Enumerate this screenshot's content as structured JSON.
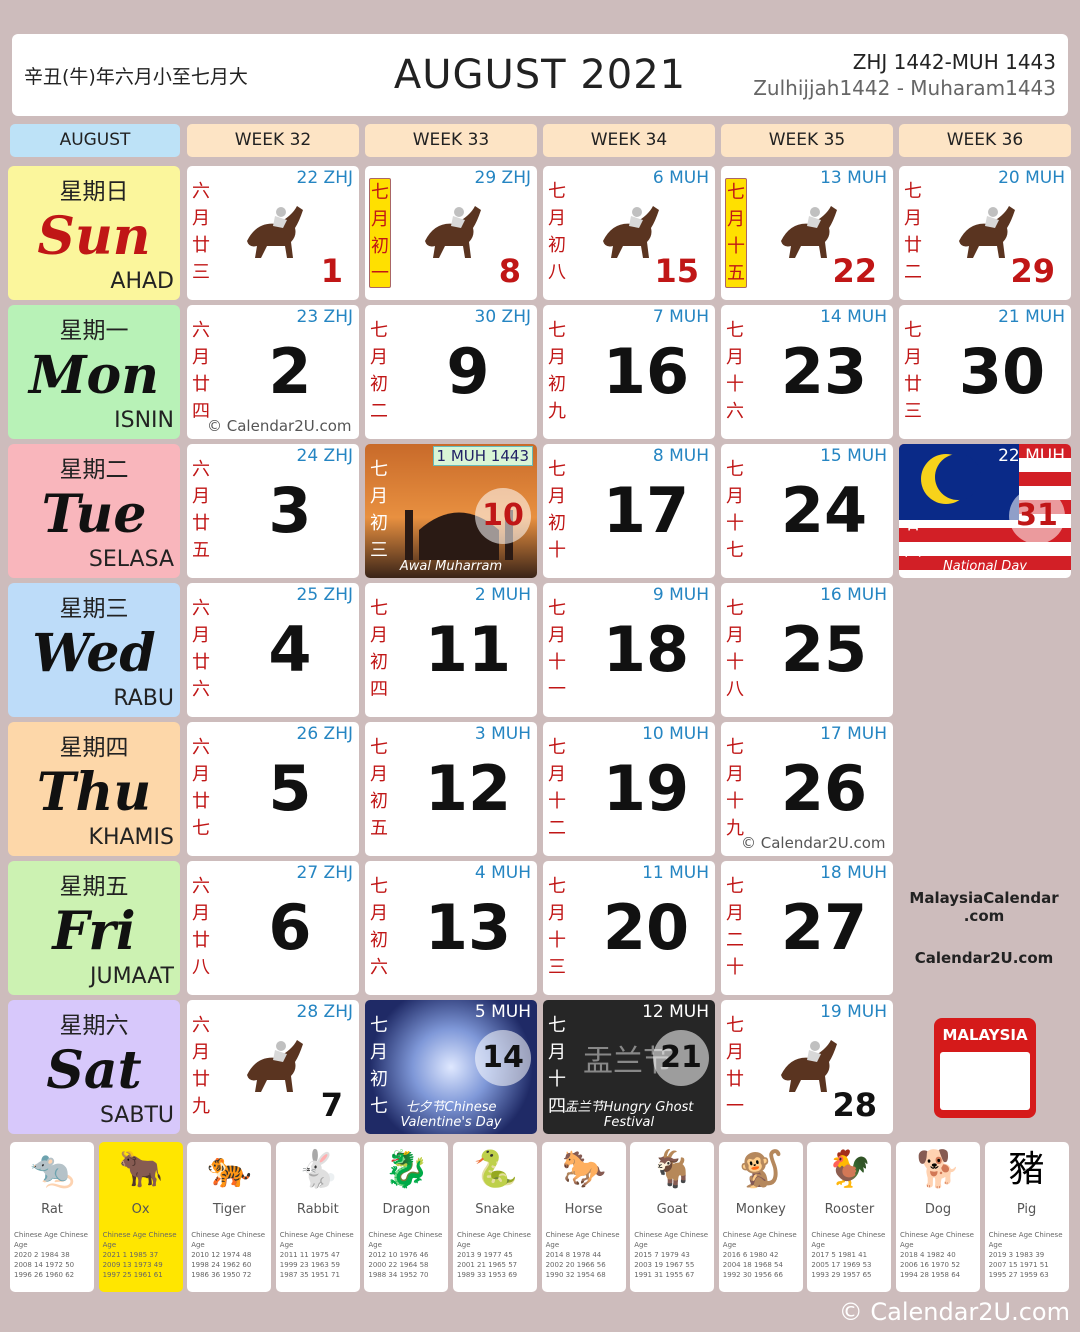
{
  "header": {
    "chinese_months": "辛丑(牛)年六月小至七月大",
    "title": "AUGUST 2021",
    "hijri_short": "ZHJ 1442-MUH 1443",
    "hijri_long": "Zulhijjah1442 - Muharam1443"
  },
  "weeks": [
    "AUGUST",
    "WEEK 32",
    "WEEK 33",
    "WEEK 34",
    "WEEK 35",
    "WEEK 36"
  ],
  "days": [
    {
      "cn": "星期日",
      "en": "Sun",
      "ml": "AHAD",
      "color": "#fbf69c"
    },
    {
      "cn": "星期一",
      "en": "Mon",
      "ml": "ISNIN",
      "color": "#b8f2b7"
    },
    {
      "cn": "星期二",
      "en": "Tue",
      "ml": "SELASA",
      "color": "#f9b6bc"
    },
    {
      "cn": "星期三",
      "en": "Wed",
      "ml": "RABU",
      "color": "#bddcf9"
    },
    {
      "cn": "星期四",
      "en": "Thu",
      "ml": "KHAMIS",
      "color": "#fdd7a9"
    },
    {
      "cn": "星期五",
      "en": "Fri",
      "ml": "JUMAAT",
      "color": "#ccf2b2"
    },
    {
      "cn": "星期六",
      "en": "Sat",
      "ml": "SABTU",
      "color": "#d7c8fb"
    }
  ],
  "cells": {
    "sun": [
      {
        "lunar": "六月廿三",
        "hij": "22 ZHJ",
        "num": "1"
      },
      {
        "lunar": "七月初一",
        "hij": "29 ZHJ",
        "num": "8"
      },
      {
        "lunar": "七月初八",
        "hij": "6 MUH",
        "num": "15"
      },
      {
        "lunar": "七月十五",
        "hij": "13 MUH",
        "num": "22"
      },
      {
        "lunar": "七月廿二",
        "hij": "20 MUH",
        "num": "29"
      }
    ],
    "mon": [
      {
        "lunar": "六月廿四",
        "hij": "23 ZHJ",
        "num": "2"
      },
      {
        "lunar": "七月初二",
        "hij": "30 ZHJ",
        "num": "9"
      },
      {
        "lunar": "七月初九",
        "hij": "7 MUH",
        "num": "16"
      },
      {
        "lunar": "七月十六",
        "hij": "14 MUH",
        "num": "23"
      },
      {
        "lunar": "七月廿三",
        "hij": "21 MUH",
        "num": "30"
      }
    ],
    "tue": [
      {
        "lunar": "六月廿五",
        "hij": "24 ZHJ",
        "num": "3"
      },
      {
        "lunar": "七月初三",
        "hij": "1 MUH 1443",
        "num": "10",
        "event": "Awal Muharram"
      },
      {
        "lunar": "七月初十",
        "hij": "8 MUH",
        "num": "17"
      },
      {
        "lunar": "七月十七",
        "hij": "15 MUH",
        "num": "24"
      },
      {
        "lunar": "七月廿四",
        "hij": "22 MUH",
        "num": "31",
        "event": "National Day"
      }
    ],
    "wed": [
      {
        "lunar": "六月廿六",
        "hij": "25 ZHJ",
        "num": "4"
      },
      {
        "lunar": "七月初四",
        "hij": "2 MUH",
        "num": "11"
      },
      {
        "lunar": "七月十一",
        "hij": "9 MUH",
        "num": "18"
      },
      {
        "lunar": "七月十八",
        "hij": "16 MUH",
        "num": "25"
      }
    ],
    "thu": [
      {
        "lunar": "六月廿七",
        "hij": "26 ZHJ",
        "num": "5"
      },
      {
        "lunar": "七月初五",
        "hij": "3 MUH",
        "num": "12"
      },
      {
        "lunar": "七月十二",
        "hij": "10 MUH",
        "num": "19"
      },
      {
        "lunar": "七月十九",
        "hij": "17 MUH",
        "num": "26"
      }
    ],
    "fri": [
      {
        "lunar": "六月廿八",
        "hij": "27 ZHJ",
        "num": "6"
      },
      {
        "lunar": "七月初六",
        "hij": "4 MUH",
        "num": "13"
      },
      {
        "lunar": "七月十三",
        "hij": "11 MUH",
        "num": "20"
      },
      {
        "lunar": "七月二十",
        "hij": "18 MUH",
        "num": "27"
      }
    ],
    "sat": [
      {
        "lunar": "六月廿九",
        "hij": "28 ZHJ",
        "num": "7"
      },
      {
        "lunar": "七月初七",
        "hij": "5 MUH",
        "num": "14",
        "event": "七夕节Chinese Valentine's Day"
      },
      {
        "lunar": "七月十四",
        "hij": "12 MUH",
        "num": "21",
        "event": "盂兰节Hungry Ghost Festival",
        "overlay": "盂兰节"
      },
      {
        "lunar": "七月廿一",
        "hij": "19 MUH",
        "num": "28"
      }
    ]
  },
  "watermarks": {
    "mon": "© Calendar2U.com",
    "thu": "© Calendar2U.com"
  },
  "side": {
    "site1a": "MalaysiaCalendar",
    "site1b": ".com",
    "site2": "Calendar2U.com",
    "badge": "MALAYSIA"
  },
  "zodiac": [
    {
      "name": "Rat",
      "icon": "🐀",
      "rows": [
        "Chinese Age Chinese Age",
        "2020 2 1984 38",
        "2008 14 1972 50",
        "1996 26 1960 62"
      ]
    },
    {
      "name": "Ox",
      "icon": "🐂",
      "rows": [
        "Chinese Age Chinese Age",
        "2021 1 1985 37",
        "2009 13 1973 49",
        "1997 25 1961 61"
      ]
    },
    {
      "name": "Tiger",
      "icon": "🐅",
      "rows": [
        "Chinese Age Chinese Age",
        "2010 12 1974 48",
        "1998 24 1962 60",
        "1986 36 1950 72"
      ]
    },
    {
      "name": "Rabbit",
      "icon": "🐇",
      "rows": [
        "Chinese Age Chinese Age",
        "2011 11 1975 47",
        "1999 23 1963 59",
        "1987 35 1951 71"
      ]
    },
    {
      "name": "Dragon",
      "icon": "🐉",
      "rows": [
        "Chinese Age Chinese Age",
        "2012 10 1976 46",
        "2000 22 1964 58",
        "1988 34 1952 70"
      ]
    },
    {
      "name": "Snake",
      "icon": "🐍",
      "rows": [
        "Chinese Age Chinese Age",
        "2013 9 1977 45",
        "2001 21 1965 57",
        "1989 33 1953 69"
      ]
    },
    {
      "name": "Horse",
      "icon": "🐎",
      "rows": [
        "Chinese Age Chinese Age",
        "2014 8 1978 44",
        "2002 20 1966 56",
        "1990 32 1954 68"
      ]
    },
    {
      "name": "Goat",
      "icon": "🐐",
      "rows": [
        "Chinese Age Chinese Age",
        "2015 7 1979 43",
        "2003 19 1967 55",
        "1991 31 1955 67"
      ]
    },
    {
      "name": "Monkey",
      "icon": "🐒",
      "rows": [
        "Chinese Age Chinese Age",
        "2016 6 1980 42",
        "2004 18 1968 54",
        "1992 30 1956 66"
      ]
    },
    {
      "name": "Rooster",
      "icon": "🐓",
      "rows": [
        "Chinese Age Chinese Age",
        "2017 5 1981 41",
        "2005 17 1969 53",
        "1993 29 1957 65"
      ]
    },
    {
      "name": "Dog",
      "icon": "🐕",
      "rows": [
        "Chinese Age Chinese Age",
        "2018 4 1982 40",
        "2006 16 1970 52",
        "1994 28 1958 64"
      ]
    },
    {
      "name": "Pig",
      "icon": "豬",
      "rows": [
        "Chinese Age Chinese Age",
        "2019 3 1983 39",
        "2007 15 1971 51",
        "1995 27 1959 63"
      ]
    }
  ],
  "footer": "© Calendar2U.com"
}
